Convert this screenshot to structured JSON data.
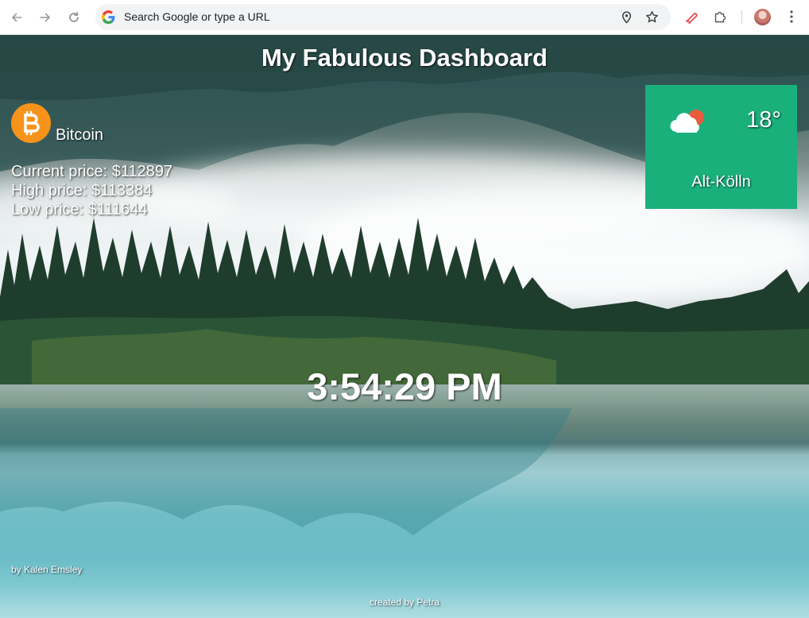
{
  "browser": {
    "omnibox_placeholder": "Search Google or type a URL",
    "icons": {
      "back": "arrow-left-icon",
      "forward": "arrow-right-icon",
      "reload": "reload-icon",
      "google": "google-logo-icon",
      "location": "location-pin-icon",
      "bookmark": "star-icon",
      "extension_active": "pen-icon",
      "extensions": "puzzle-icon",
      "profile": "avatar",
      "menu": "more-vertical-icon"
    }
  },
  "dashboard": {
    "title": "My Fabulous Dashboard",
    "crypto": {
      "name": "Bitcoin",
      "icon": "bitcoin-logo-icon",
      "current_price": "Current price: $112897",
      "high_price": "High price: $113384",
      "low_price": "Low price: $111644"
    },
    "weather": {
      "temperature": "18°",
      "city": "Alt-Kölln",
      "icon": "partly-cloudy-icon",
      "card_color": "#1ab07c"
    },
    "time": "3:54:29 PM",
    "photo_credit": "by Kalen Emsley",
    "author_credit": "created by Petra"
  }
}
